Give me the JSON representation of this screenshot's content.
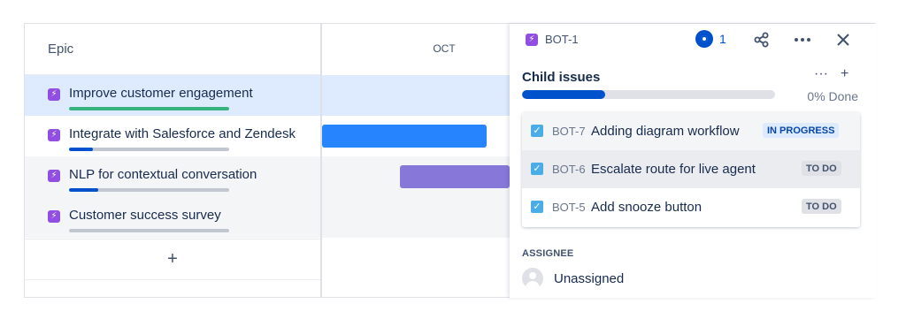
{
  "epic_panel": {
    "header": "Epic",
    "add_symbol": "+",
    "epics": [
      {
        "label": "Improve customer engagement",
        "progress": 1.0,
        "progress_color": "#36b37e",
        "selected": true
      },
      {
        "label": "Integrate with Salesforce and Zendesk",
        "progress": 0.15,
        "progress_color": "#0052cc",
        "selected": false
      },
      {
        "label": "NLP for contextual conversation",
        "progress": 0.18,
        "progress_color": "#0052cc",
        "selected": false
      },
      {
        "label": "Customer success survey",
        "progress": 0.0,
        "progress_color": "#0052cc",
        "selected": false
      }
    ]
  },
  "timeline": {
    "month": "OCT",
    "bars": [
      {
        "epic": "Integrate with Salesforce and Zendesk",
        "color": "#2684ff"
      },
      {
        "epic": "NLP for contextual conversation",
        "color": "#8777d9"
      }
    ]
  },
  "detail_panel": {
    "issue_key": "BOT-1",
    "watch_count": "1",
    "child_issues_title": "Child issues",
    "more_symbol": "···",
    "add_symbol": "+",
    "progress_done": 0.33,
    "done_text": "0% Done",
    "child_issues": [
      {
        "key": "BOT-7",
        "summary": "Adding diagram workflow",
        "status": "IN PROGRESS",
        "status_bg": "#deebff",
        "status_color": "#0747a6"
      },
      {
        "key": "BOT-6",
        "summary": "Escalate route for live agent",
        "status": "TO DO",
        "status_bg": "#dfe1e6",
        "status_color": "#42526e"
      },
      {
        "key": "BOT-5",
        "summary": "Add snooze button",
        "status": "TO DO",
        "status_bg": "#dfe1e6",
        "status_color": "#42526e"
      }
    ],
    "assignee_label": "ASSIGNEE",
    "assignee_value": "Unassigned"
  },
  "colors": {
    "epic_purple": "#904ee2",
    "selected_row": "#deebff",
    "row_alt": "#f4f5f7",
    "accent_blue": "#0052cc"
  }
}
